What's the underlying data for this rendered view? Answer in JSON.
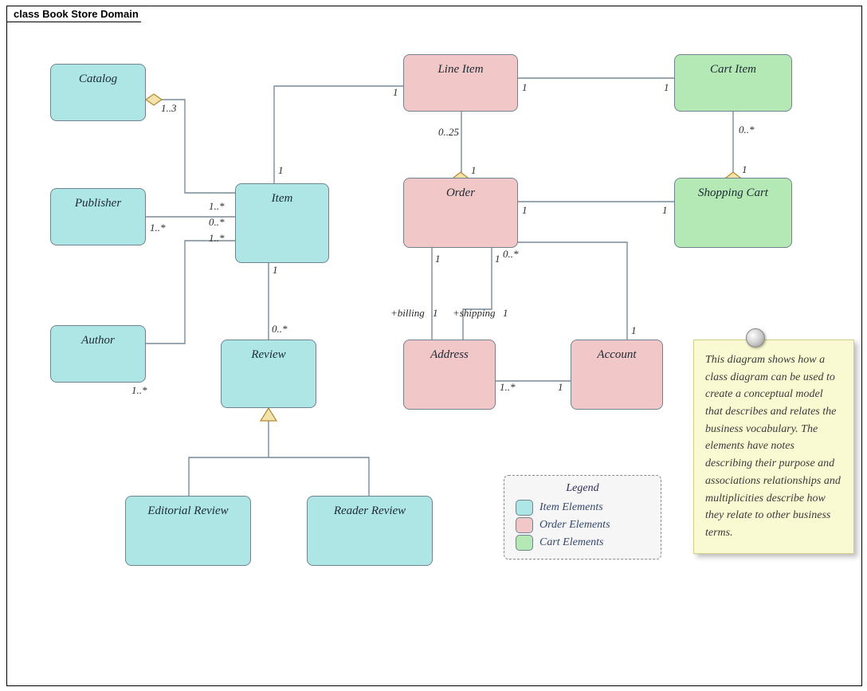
{
  "frame_title": "class Book Store Domain",
  "nodes": {
    "catalog": "Catalog",
    "publisher": "Publisher",
    "author": "Author",
    "item": "Item",
    "review": "Review",
    "editorial": "Editorial Review",
    "reader": "Reader Review",
    "lineitem": "Line Item",
    "order": "Order",
    "address": "Address",
    "account": "Account",
    "cartitem": "Cart Item",
    "shoppingcart": "Shopping Cart"
  },
  "mult": {
    "catalog_item": "1..3",
    "pub_near": "1..*",
    "pub_far": "1..*",
    "item_mid": "0..*",
    "author_item": "1..*",
    "author_near": "1..*",
    "item_line": "1",
    "item_top": "1",
    "item_review_top": "1",
    "item_review_bot": "0..*",
    "line_left": "1",
    "line_right": "1",
    "line_order": "0..25",
    "order_line": "1",
    "order_cart_l": "1",
    "order_cart_r": "1",
    "order_many": "0..*",
    "addr_l": "1",
    "addr_r": "1",
    "addr_acct_l": "1..*",
    "addr_acct_r": "1",
    "acct_top": "1",
    "cart_line": "1",
    "cart_many": "0..*",
    "cart_one": "1",
    "billing": "+billing",
    "billing1": "1",
    "shipping": "+shipping",
    "shipping1": "1"
  },
  "legend": {
    "title": "Legend",
    "items": [
      {
        "label": "Item Elements",
        "cls": "item-el"
      },
      {
        "label": "Order Elements",
        "cls": "order-el"
      },
      {
        "label": "Cart Elements",
        "cls": "cart-el"
      }
    ]
  },
  "note": "This diagram shows how a class diagram can be used to create a conceptual model that describes and relates the business vocabulary. The elements have notes describing their purpose and associations relationships and multiplicities describe how they relate to other business terms."
}
